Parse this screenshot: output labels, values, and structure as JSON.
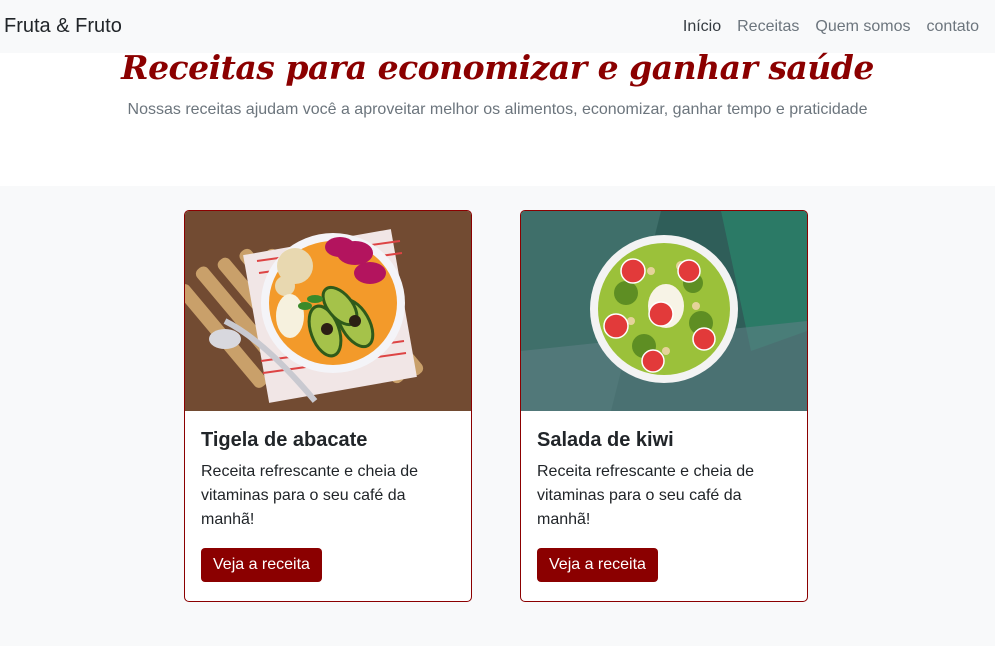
{
  "navbar": {
    "brand": "Fruta & Fruto",
    "links": [
      {
        "label": "Início",
        "active": true
      },
      {
        "label": "Receitas",
        "active": false
      },
      {
        "label": "Quem somos",
        "active": false
      },
      {
        "label": "contato",
        "active": false
      }
    ]
  },
  "hero": {
    "title": "Receitas para economizar e ganhar saúde",
    "subtitle": "Nossas receitas ajudam você a aproveitar melhor os alimentos, economizar, ganhar tempo e praticidade"
  },
  "cards": [
    {
      "title": "Tigela de abacate",
      "text": "Receita refrescante e cheia de vitaminas para o seu café da manhã!",
      "button": "Veja a receita",
      "image_icon": "avocado-bowl-image"
    },
    {
      "title": "Salada de kiwi",
      "text": "Receita refrescante e cheia de vitaminas para o seu café da manhã!",
      "button": "Veja a receita",
      "image_icon": "kiwi-bowl-image"
    }
  ],
  "colors": {
    "accent": "#8b0000",
    "navbar_bg": "#f8f9fa",
    "muted_text": "#6c757d"
  }
}
